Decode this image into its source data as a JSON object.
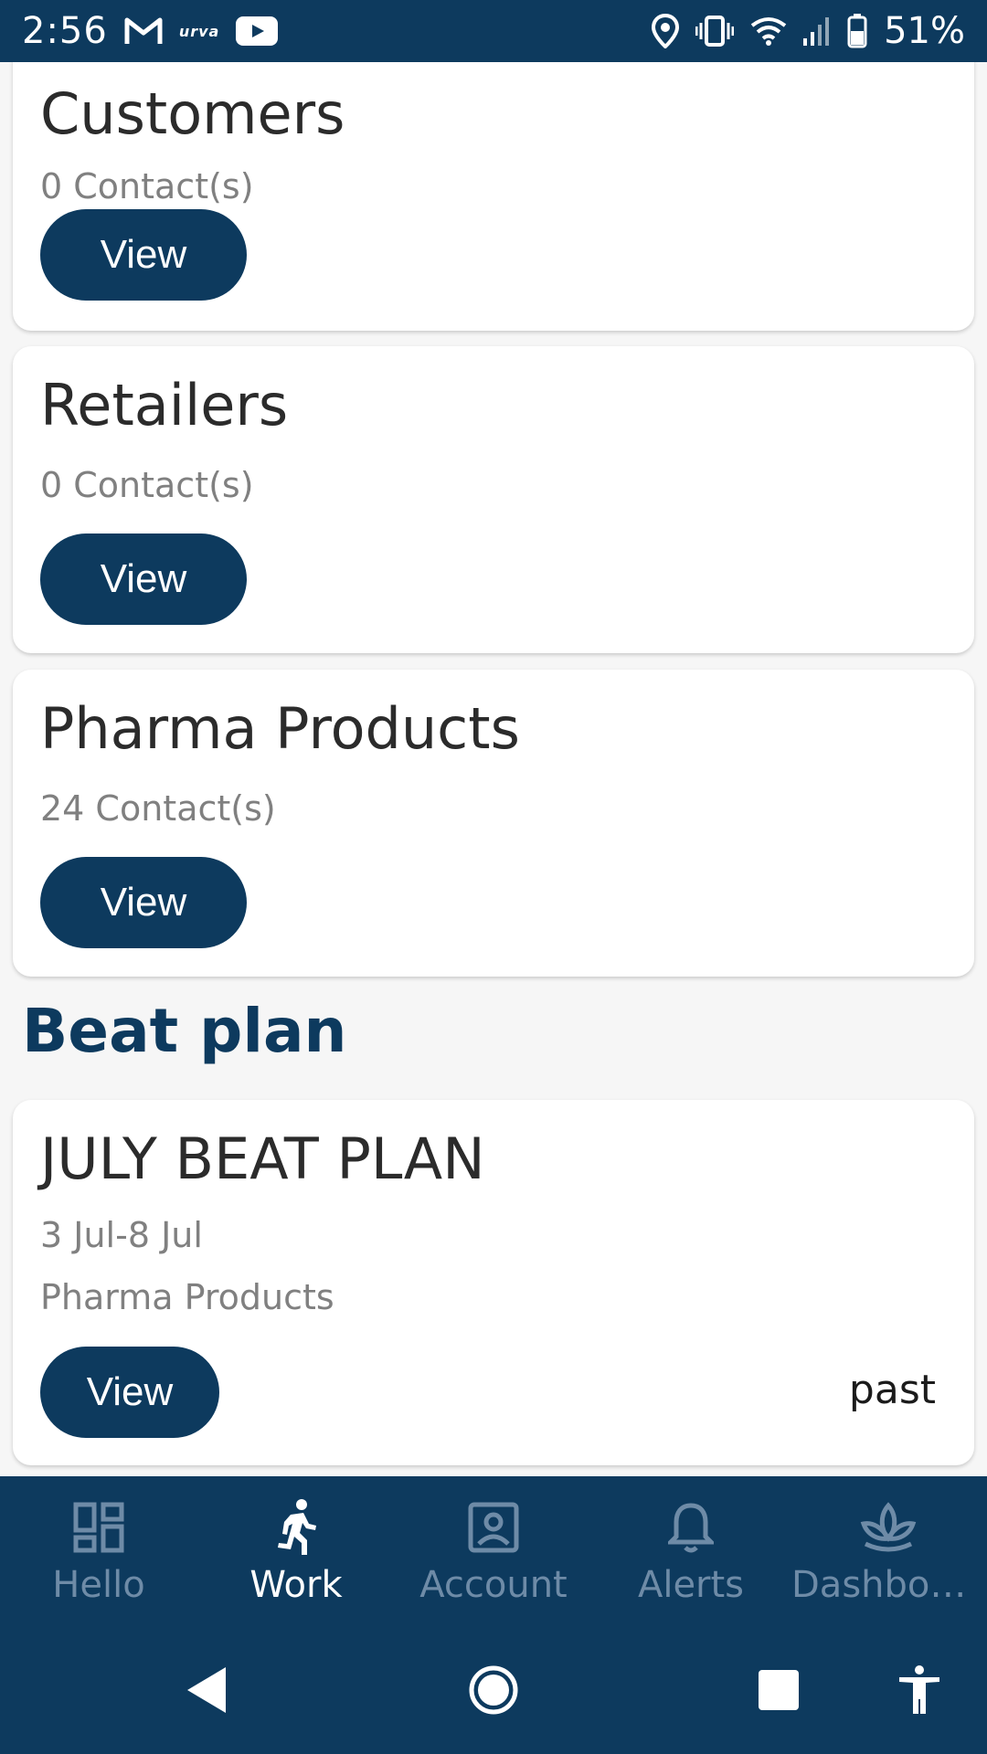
{
  "status_bar": {
    "time": "2:56",
    "carrier_badge": "urva",
    "battery_percent": "51%",
    "icons": [
      "gmail-icon",
      "urva-icon",
      "youtube-icon",
      "location-icon",
      "vibrate-icon",
      "wifi-icon",
      "signal-icon",
      "battery-icon"
    ]
  },
  "cards": [
    {
      "title": "Customers",
      "subtitle": "0 Contact(s)",
      "button_label": "View"
    },
    {
      "title": "Retailers",
      "subtitle": "0 Contact(s)",
      "button_label": "View"
    },
    {
      "title": "Pharma Products",
      "subtitle": "24 Contact(s)",
      "button_label": "View"
    }
  ],
  "beat_plan": {
    "heading": "Beat plan",
    "card": {
      "title": "JULY BEAT PLAN",
      "date_range": "3 Jul-8 Jul",
      "category": "Pharma Products",
      "button_label": "View",
      "status": "past"
    }
  },
  "bottom_nav": {
    "active": "Work",
    "items": [
      {
        "label": "Hello",
        "icon": "dashboard-grid-icon"
      },
      {
        "label": "Work",
        "icon": "running-person-icon"
      },
      {
        "label": "Account",
        "icon": "account-box-icon"
      },
      {
        "label": "Alerts",
        "icon": "bell-icon"
      },
      {
        "label": "Dashboa...",
        "icon": "lotus-icon"
      }
    ]
  },
  "system_nav": {
    "buttons": [
      "back-icon",
      "home-icon",
      "recents-icon",
      "accessibility-icon"
    ]
  },
  "colors": {
    "primary": "#0d3a5e",
    "background": "#f6f6f6",
    "card": "#ffffff",
    "subtitle": "#808080",
    "nav_inactive": "#6e8ba7"
  }
}
